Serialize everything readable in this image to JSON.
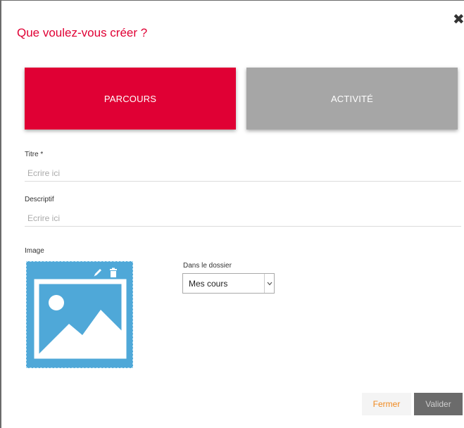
{
  "dialog": {
    "title": "Que voulez-vous créer ?",
    "close_label": "✖"
  },
  "types": {
    "parcours_label": "PARCOURS",
    "activite_label": "ACTIVITÉ",
    "selected": "PARCOURS"
  },
  "form": {
    "titre_label": "Titre *",
    "titre_placeholder": "Ecrire ici",
    "titre_value": "",
    "descriptif_label": "Descriptif",
    "descriptif_placeholder": "Ecrire ici",
    "descriptif_value": "",
    "image_label": "Image",
    "folder_label": "Dans le dossier",
    "folder_value": "Mes cours"
  },
  "icons": {
    "image_placeholder": "image-placeholder-icon",
    "edit": "pencil-icon",
    "delete": "trash-icon",
    "close": "close-icon",
    "dropdown": "chevron-down-icon"
  },
  "footer": {
    "fermer_label": "Fermer",
    "valider_label": "Valider"
  },
  "colors": {
    "accent": "#e00034",
    "inactive": "#a6a6a6",
    "image_bg": "#4fa8d8",
    "fermer_text": "#f0891e",
    "valider_bg": "#6b6b6b"
  }
}
